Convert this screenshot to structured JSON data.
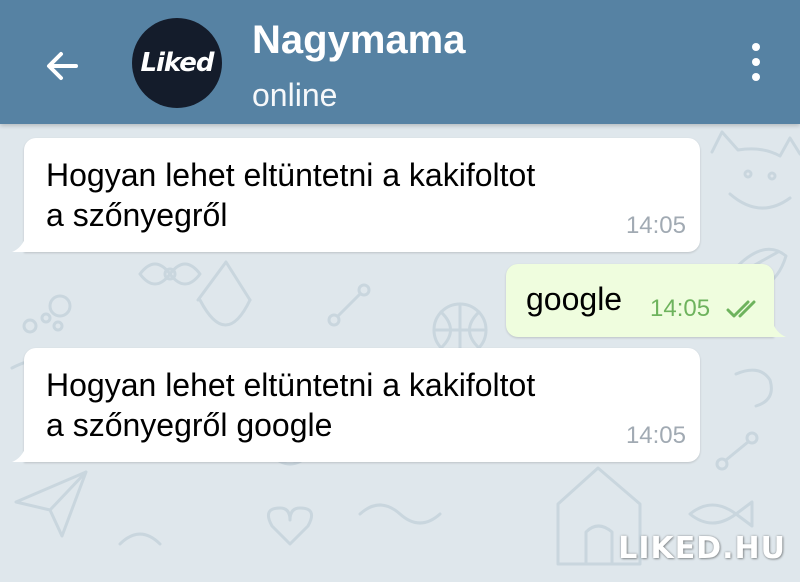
{
  "header": {
    "back_icon": "arrow-left-icon",
    "avatar_text": "Liked",
    "contact_name": "Nagymama",
    "status": "online",
    "menu_icon": "more-vertical-icon"
  },
  "messages": [
    {
      "direction": "incoming",
      "lines": [
        "Hogyan lehet eltüntetni a kakifoltot",
        "a szőnyegről"
      ],
      "time": "14:05"
    },
    {
      "direction": "outgoing",
      "lines": [
        "google"
      ],
      "time": "14:05",
      "status_icon": "double-check-icon"
    },
    {
      "direction": "incoming",
      "lines": [
        "Hogyan lehet eltüntetni a kakifoltot",
        "a szőnyegről google"
      ],
      "time": "14:05"
    }
  ],
  "watermark": "LIKED.HU",
  "colors": {
    "header": "#5682a3",
    "chat_background": "#dfe7ec",
    "incoming_bubble": "#ffffff",
    "outgoing_bubble": "#effdde",
    "incoming_time": "#a1aab3",
    "outgoing_time": "#6eb35d"
  }
}
